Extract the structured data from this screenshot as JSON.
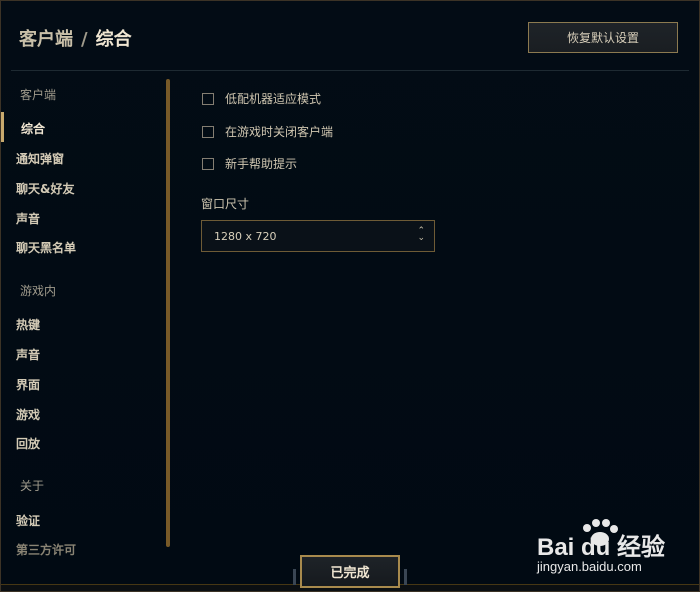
{
  "header": {
    "breadcrumb_parent": "客户端",
    "breadcrumb_sep": "/",
    "breadcrumb_current": "综合",
    "restore_label": "恢复默认设置"
  },
  "sidebar": {
    "sections": [
      {
        "label": "客户端",
        "items": [
          "综合",
          "通知弹窗",
          "聊天&好友",
          "声音",
          "聊天黑名单"
        ]
      },
      {
        "label": "游戏内",
        "items": [
          "热键",
          "声音",
          "界面",
          "游戏",
          "回放"
        ]
      },
      {
        "label": "关于",
        "items": [
          "验证",
          "第三方许可"
        ]
      }
    ],
    "active_item": "综合"
  },
  "content": {
    "checkboxes": [
      {
        "label": "低配机器适应模式",
        "checked": false
      },
      {
        "label": "在游戏时关闭客户端",
        "checked": false
      },
      {
        "label": "新手帮助提示",
        "checked": false
      }
    ],
    "window_size_label": "窗口尺寸",
    "window_size_value": "1280 x 720"
  },
  "footer": {
    "done_label": "已完成"
  },
  "watermark": {
    "main": "Bai du 经验",
    "sub": "jingyan.baidu.com"
  },
  "colors": {
    "accent_gold": "#c8aa6e",
    "background": "#010a13",
    "text": "#f0e6d2"
  }
}
